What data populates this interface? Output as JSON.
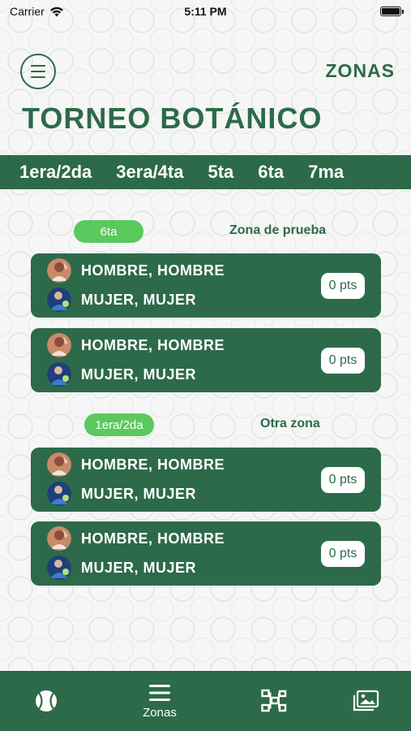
{
  "status_bar": {
    "carrier": "Carrier",
    "time": "5:11 PM"
  },
  "header": {
    "zonas_link": "ZONAS",
    "title": "TORNEO BOTÁNICO"
  },
  "tabs": [
    "1era/2da",
    "3era/4ta",
    "5ta",
    "6ta",
    "7ma"
  ],
  "groups": [
    {
      "category": "6ta",
      "zone": "Zona de prueba",
      "matches": [
        {
          "team_a": "HOMBRE, HOMBRE",
          "team_b": "MUJER, MUJER",
          "points": "0 pts"
        },
        {
          "team_a": "HOMBRE, HOMBRE",
          "team_b": "MUJER, MUJER",
          "points": "0 pts"
        }
      ]
    },
    {
      "category": "1era/2da",
      "zone": "Otra zona",
      "matches": [
        {
          "team_a": "HOMBRE, HOMBRE",
          "team_b": "MUJER, MUJER",
          "points": "0 pts"
        },
        {
          "team_a": "HOMBRE, HOMBRE",
          "team_b": "MUJER, MUJER",
          "points": "0 pts"
        }
      ]
    }
  ],
  "bottom_nav": {
    "items": [
      {
        "icon": "tennis-ball-icon",
        "label": ""
      },
      {
        "icon": "list-icon",
        "label": "Zonas"
      },
      {
        "icon": "bracket-icon",
        "label": ""
      },
      {
        "icon": "gallery-icon",
        "label": ""
      }
    ]
  },
  "colors": {
    "primary": "#2d6a4a",
    "pill": "#5bc95e",
    "background": "#f6f7f6",
    "badge": "#ffffff"
  }
}
